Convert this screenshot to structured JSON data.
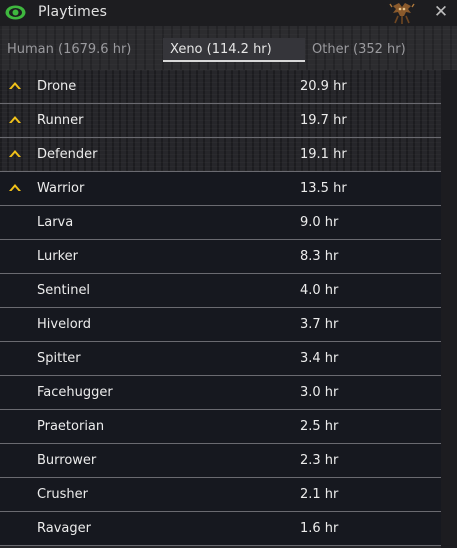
{
  "window": {
    "title": "Playtimes",
    "title_icon": "eye-icon",
    "mascot_icon": "xeno-mascot-icon",
    "close_label": "✕"
  },
  "colors": {
    "title_icon_green": "#3fb83f",
    "rank_chevron_yellow": "#f2c21a",
    "row_bg": "#16181f",
    "text": "#ececec"
  },
  "tabs": [
    {
      "label": "Human (1679.6 hr)",
      "selected": false
    },
    {
      "label": "Xeno (114.2 hr)",
      "selected": true
    },
    {
      "label": "Other (352 hr)",
      "selected": false
    }
  ],
  "rows": [
    {
      "name": "Drone",
      "time": "20.9 hr",
      "icon": "rank-chevron-icon"
    },
    {
      "name": "Runner",
      "time": "19.7 hr",
      "icon": "rank-chevron-icon"
    },
    {
      "name": "Defender",
      "time": "19.1 hr",
      "icon": "rank-chevron-icon"
    },
    {
      "name": "Warrior",
      "time": "13.5 hr",
      "icon": "rank-chevron-icon"
    },
    {
      "name": "Larva",
      "time": "9.0 hr",
      "icon": ""
    },
    {
      "name": "Lurker",
      "time": "8.3 hr",
      "icon": ""
    },
    {
      "name": "Sentinel",
      "time": "4.0 hr",
      "icon": ""
    },
    {
      "name": "Hivelord",
      "time": "3.7 hr",
      "icon": ""
    },
    {
      "name": "Spitter",
      "time": "3.4 hr",
      "icon": ""
    },
    {
      "name": "Facehugger",
      "time": "3.0 hr",
      "icon": ""
    },
    {
      "name": "Praetorian",
      "time": "2.5 hr",
      "icon": ""
    },
    {
      "name": "Burrower",
      "time": "2.3 hr",
      "icon": ""
    },
    {
      "name": "Crusher",
      "time": "2.1 hr",
      "icon": ""
    },
    {
      "name": "Ravager",
      "time": "1.6 hr",
      "icon": ""
    }
  ]
}
